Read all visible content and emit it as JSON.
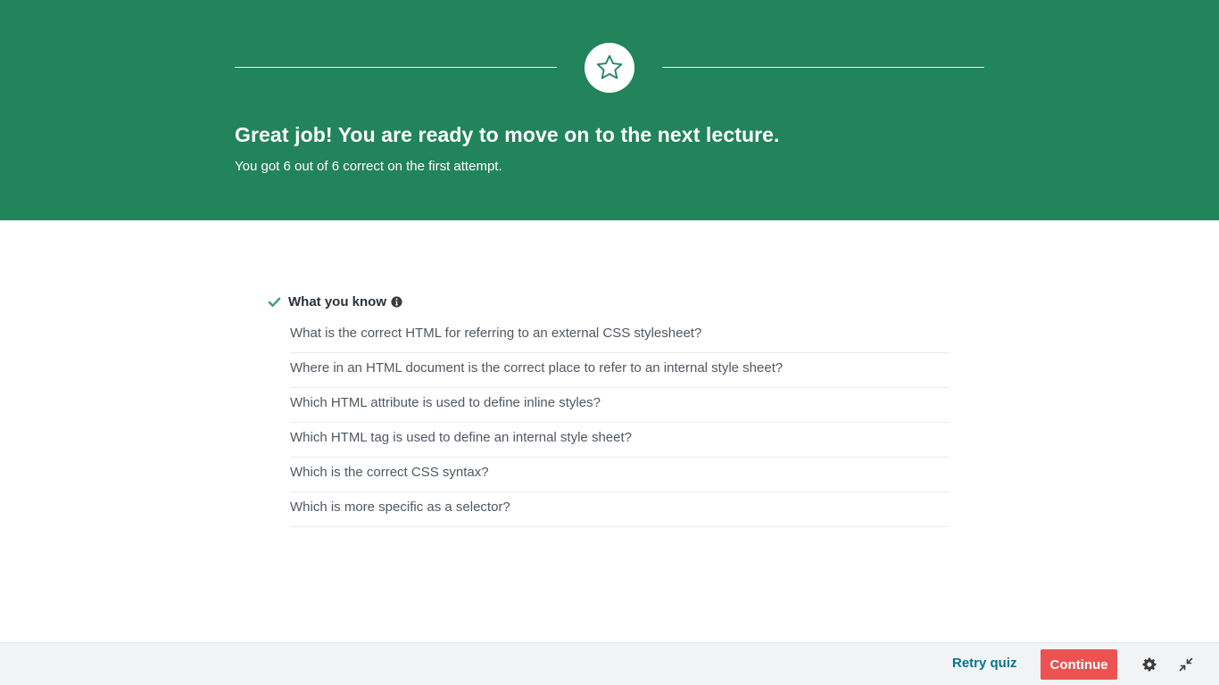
{
  "banner": {
    "headline": "Great job! You are ready to move on to the next lecture.",
    "subline": "You got 6 out of 6 correct on the first attempt.",
    "badge_icon": "star-icon",
    "background_color": "#21845a"
  },
  "know_section": {
    "title": "What you know",
    "status_icon": "check-icon",
    "info_icon": "info-icon",
    "questions": [
      "What is the correct HTML for referring to an external CSS stylesheet?",
      "Where in an HTML document is the correct place to refer to an internal style sheet?",
      "Which HTML attribute is used to define inline styles?",
      "Which HTML tag is used to define an internal style sheet?",
      "Which is the correct CSS syntax?",
      "Which is more specific as a selector?"
    ]
  },
  "footer": {
    "retry_label": "Retry quiz",
    "continue_label": "Continue",
    "settings_icon": "gear-icon",
    "exit_fullscreen_icon": "compress-icon",
    "continue_color": "#ec5252",
    "retry_color": "#007791"
  }
}
